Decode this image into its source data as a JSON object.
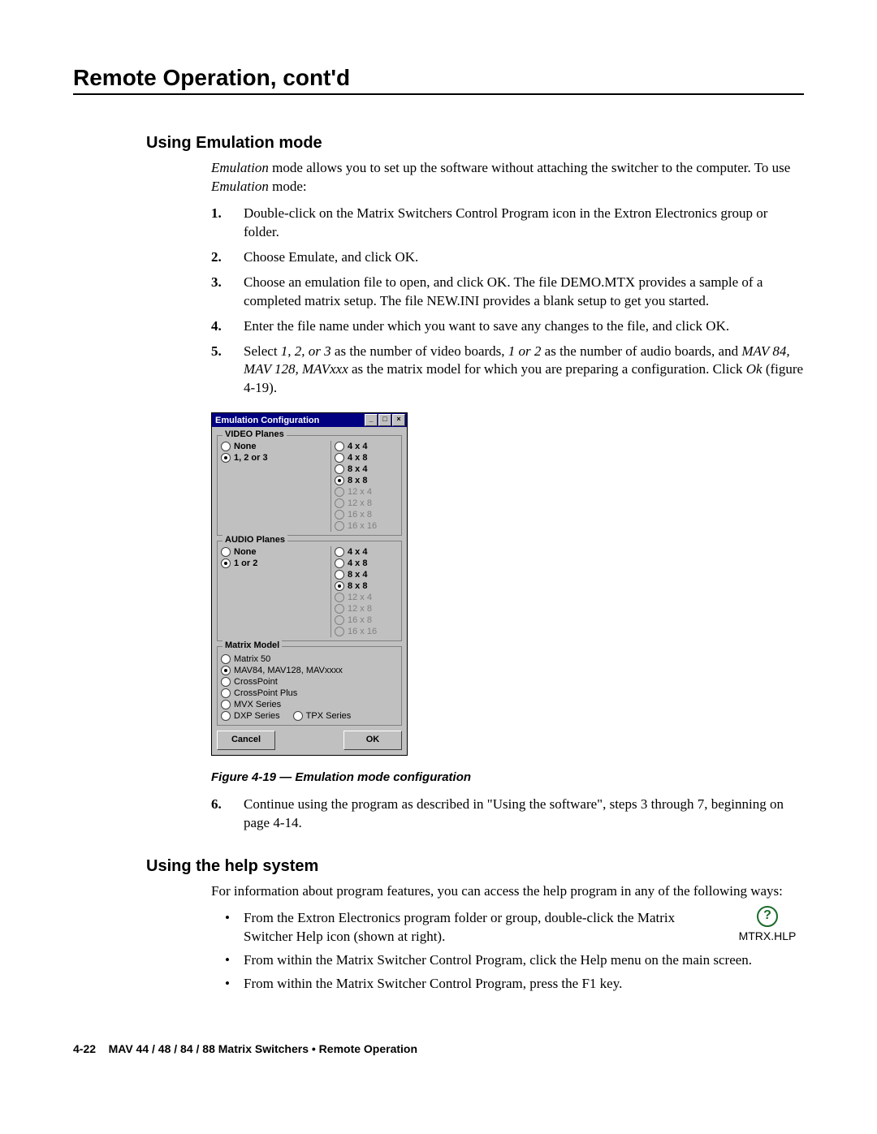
{
  "chapter_title": "Remote Operation, cont'd",
  "section1": {
    "title": "Using Emulation mode",
    "intro_html": "<span class='ital'>Emulation</span> mode allows you to set up the software without attaching the switcher to the computer.  To use <span class='ital'>Emulation</span> mode:",
    "steps": [
      "Double-click on the Matrix Switchers Control Program icon in the Extron Electronics group or folder.",
      "Choose Emulate, and click OK.",
      "Choose an emulation file to open, and click OK.  The file DEMO.MTX provides a sample of a completed matrix setup.  The file NEW.INI provides a blank setup to get you started.",
      "Enter the file name under which you want to save any changes to the file, and click OK.",
      "Select <span class='ital'>1, 2, or 3</span> as the number of video boards, <span class='ital'>1 or 2</span> as the number of audio boards, and <span class='ital'>MAV 84, MAV 128, MAVxxx</span> as the matrix model for which you are preparing a configuration.  Click <span class='ital'>Ok</span> (figure 4-19)."
    ],
    "step6": "Continue using the program as described in \"Using the software\", steps 3 through 7, beginning on page 4-14."
  },
  "dialog": {
    "title": "Emulation Configuration",
    "video_legend": "VIDEO Planes",
    "video_left": [
      {
        "label": "None",
        "selected": false,
        "bold": true
      },
      {
        "label": "1, 2 or 3",
        "selected": true,
        "bold": true
      }
    ],
    "video_right": [
      {
        "label": "4 x 4",
        "selected": false,
        "disabled": false,
        "bold": true
      },
      {
        "label": "4 x 8",
        "selected": false,
        "disabled": false,
        "bold": true
      },
      {
        "label": "8 x 4",
        "selected": false,
        "disabled": false,
        "bold": true
      },
      {
        "label": "8 x 8",
        "selected": true,
        "disabled": false,
        "bold": true
      },
      {
        "label": "12 x 4",
        "selected": false,
        "disabled": true,
        "bold": false
      },
      {
        "label": "12 x 8",
        "selected": false,
        "disabled": true,
        "bold": false
      },
      {
        "label": "16 x 8",
        "selected": false,
        "disabled": true,
        "bold": false
      },
      {
        "label": "16 x 16",
        "selected": false,
        "disabled": true,
        "bold": false
      }
    ],
    "audio_legend": "AUDIO Planes",
    "audio_left": [
      {
        "label": "None",
        "selected": false,
        "bold": true
      },
      {
        "label": "1 or 2",
        "selected": true,
        "bold": true
      }
    ],
    "audio_right": [
      {
        "label": "4 x 4",
        "selected": false,
        "disabled": false,
        "bold": true
      },
      {
        "label": "4 x 8",
        "selected": false,
        "disabled": false,
        "bold": true
      },
      {
        "label": "8 x 4",
        "selected": false,
        "disabled": false,
        "bold": true
      },
      {
        "label": "8 x 8",
        "selected": true,
        "disabled": false,
        "bold": true
      },
      {
        "label": "12 x 4",
        "selected": false,
        "disabled": true,
        "bold": false
      },
      {
        "label": "12 x 8",
        "selected": false,
        "disabled": true,
        "bold": false
      },
      {
        "label": "16 x 8",
        "selected": false,
        "disabled": true,
        "bold": false
      },
      {
        "label": "16 x 16",
        "selected": false,
        "disabled": true,
        "bold": false
      }
    ],
    "model_legend": "Matrix Model",
    "models": [
      {
        "label": "Matrix 50",
        "selected": false
      },
      {
        "label": "MAV84, MAV128, MAVxxxx",
        "selected": true
      },
      {
        "label": "CrossPoint",
        "selected": false
      },
      {
        "label": "CrossPoint Plus",
        "selected": false
      },
      {
        "label": "MVX Series",
        "selected": false
      }
    ],
    "model_row_two": [
      {
        "label": "DXP Series",
        "selected": false
      },
      {
        "label": "TPX Series",
        "selected": false
      }
    ],
    "cancel": "Cancel",
    "ok": "OK"
  },
  "fig_caption": "Figure 4-19 — Emulation mode configuration",
  "section2": {
    "title": "Using the help system",
    "intro": "For information about program features, you can access the help program in any of the following ways:",
    "bullets": [
      "From the Extron Electronics program folder or group, double-click the Matrix Switcher Help icon (shown at right).",
      "From within the Matrix Switcher Control Program, click the Help menu on the main screen.",
      "From within the Matrix Switcher Control Program, press the F1 key."
    ],
    "help_icon_label": "MTRX.HLP"
  },
  "footer": {
    "page": "4-22",
    "text": "MAV 44 / 48 / 84 / 88 Matrix Switchers • Remote Operation"
  }
}
